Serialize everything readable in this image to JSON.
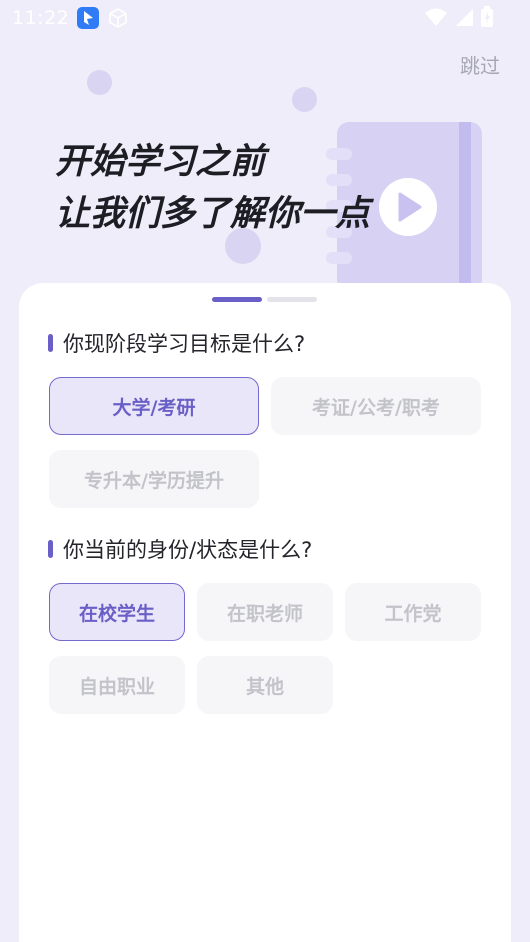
{
  "status_bar": {
    "time": "11:22"
  },
  "header": {
    "skip_label": "跳过",
    "headline_line1": "开始学习之前",
    "headline_line2": "让我们多了解你一点"
  },
  "questions": [
    {
      "title": "你现阶段学习目标是什么?",
      "options": [
        {
          "label": "大学/考研",
          "selected": true
        },
        {
          "label": "考证/公考/职考",
          "selected": false
        },
        {
          "label": "专升本/学历提升",
          "selected": false
        }
      ]
    },
    {
      "title": "你当前的身份/状态是什么?",
      "options": [
        {
          "label": "在校学生",
          "selected": true
        },
        {
          "label": "在职老师",
          "selected": false
        },
        {
          "label": "工作党",
          "selected": false
        },
        {
          "label": "自由职业",
          "selected": false
        },
        {
          "label": "其他",
          "selected": false
        }
      ]
    }
  ],
  "pager": {
    "current": 1,
    "total": 2
  },
  "colors": {
    "accent": "#6a5fc6",
    "background": "#efedf9"
  }
}
